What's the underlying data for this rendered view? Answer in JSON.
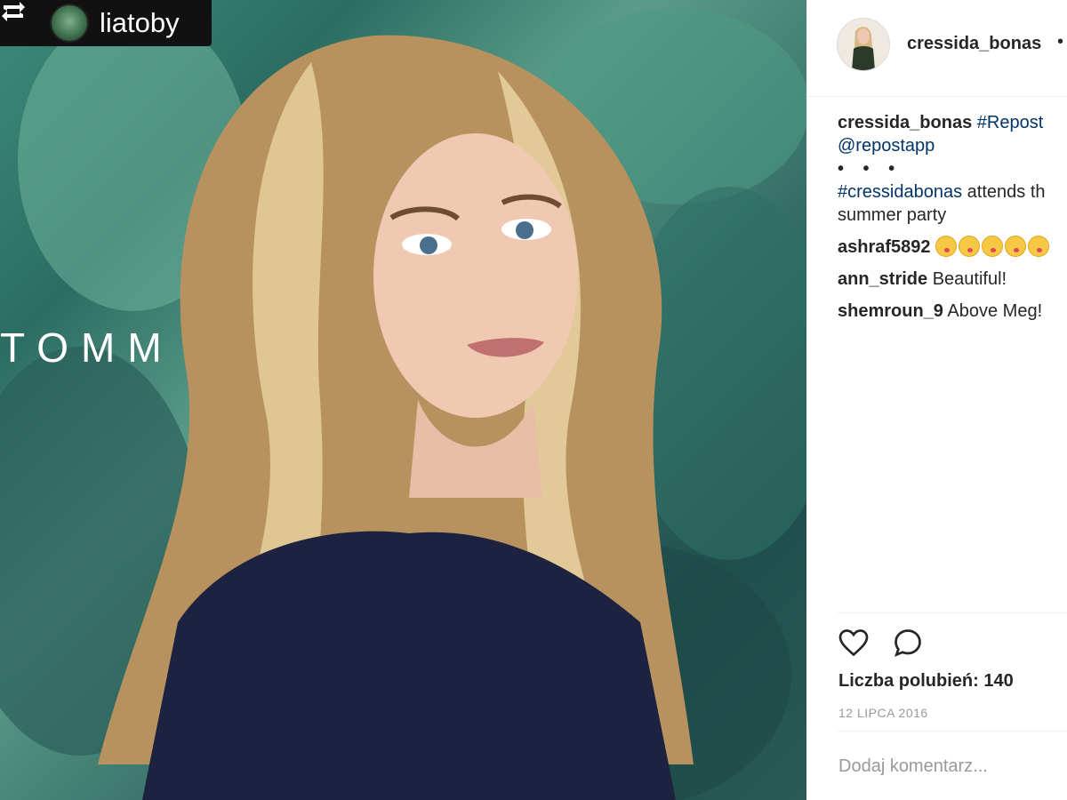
{
  "photo": {
    "repost_user": "liatoby",
    "background_brand_text": "TOMM"
  },
  "post": {
    "header_user": "cressida_bonas",
    "header_dot": "•",
    "caption": {
      "user": "cressida_bonas",
      "line1_tag": "#Repost",
      "line2": "@repostapp",
      "dots": "• • •",
      "tag2": "#cressidabonas",
      "line3_rest": " attends th",
      "line4": "summer party"
    },
    "comments": [
      {
        "user": "ashraf5892",
        "text": "",
        "emoji_count": 5
      },
      {
        "user": "ann_stride",
        "text": "Beautiful!"
      },
      {
        "user": "shemroun_9",
        "text": "Above Meg!"
      }
    ],
    "likes_label": "Liczba polubień: 140",
    "date": "12 LIPCA 2016",
    "add_comment_placeholder": "Dodaj komentarz..."
  },
  "icons": {
    "repost": "repost-icon",
    "like": "heart-icon",
    "comment": "comment-icon"
  }
}
